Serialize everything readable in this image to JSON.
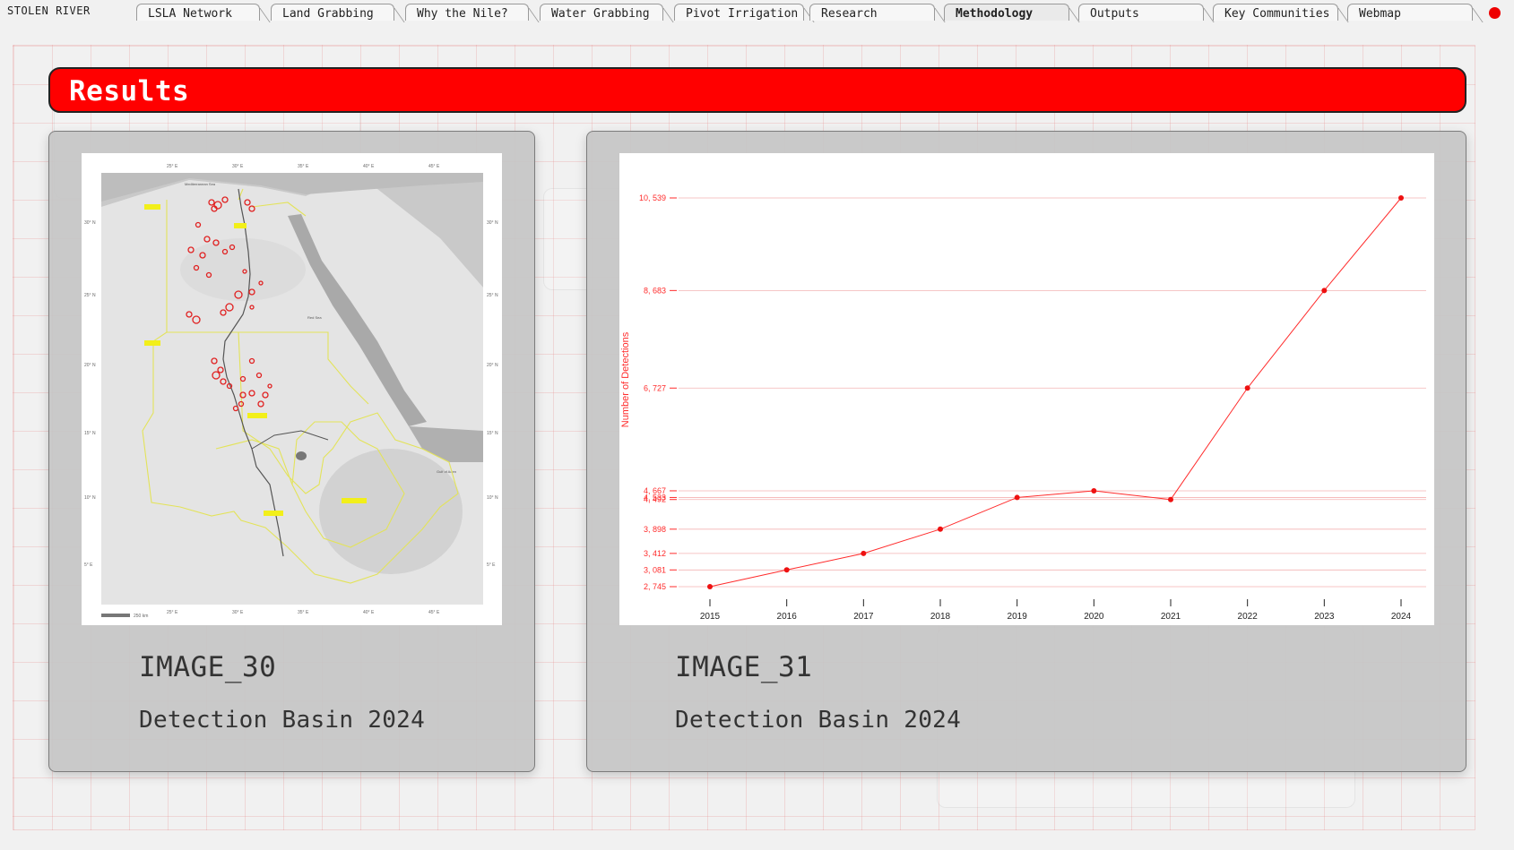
{
  "brand": "STOLEN RIVER",
  "tabs": [
    {
      "label": "LSLA Network",
      "active": false
    },
    {
      "label": "Land Grabbing",
      "active": false
    },
    {
      "label": "Why the Nile?",
      "active": false
    },
    {
      "label": "Water Grabbing",
      "active": false
    },
    {
      "label": "Pivot Irrigation",
      "active": false
    },
    {
      "label": "Research",
      "active": false
    },
    {
      "label": "Methodology",
      "active": true
    },
    {
      "label": "Outputs",
      "active": false
    },
    {
      "label": "Key Communities",
      "active": false
    },
    {
      "label": "Webmap",
      "active": false
    }
  ],
  "colors": {
    "accent": "#ff0000",
    "status_dot": "#ee0000"
  },
  "section_title": "Results",
  "cards": [
    {
      "title": "IMAGE_30",
      "subtitle": "Detection Basin 2024",
      "image": "map of the Nile basin with detection sites",
      "map": {
        "lon_labels": [
          "25° E",
          "30° E",
          "35° E",
          "40° E",
          "45° E"
        ],
        "lat_labels": [
          "30° N",
          "25° N",
          "20° N",
          "15° N",
          "10° N",
          "5° E"
        ],
        "scale_label": "250 km",
        "sea_labels": [
          "Mediterranean Sea",
          "Red Sea",
          "Gulf of Aden"
        ]
      }
    },
    {
      "title": "IMAGE_31",
      "subtitle": "Detection Basin 2024",
      "image": "line chart of number of detections per year"
    }
  ],
  "chart_data": {
    "type": "line",
    "title": "",
    "xlabel": "",
    "ylabel": "Number of Detections",
    "x": [
      2015,
      2016,
      2017,
      2018,
      2019,
      2020,
      2021,
      2022,
      2023,
      2024
    ],
    "x_tick_labels": [
      "2015",
      "2016",
      "2017",
      "2018",
      "2019",
      "2020",
      "2021",
      "2022",
      "2023",
      "2024"
    ],
    "y_tick_labels": [
      "2, 745",
      "3, 081",
      "3, 412",
      "3, 898",
      "4, 533",
      "4, 667",
      "4, 492",
      "6, 727",
      "8, 683",
      "10, 539"
    ],
    "series": [
      {
        "values": [
          2745,
          3081,
          3412,
          3898,
          4533,
          4667,
          4492,
          6727,
          8683,
          10539
        ]
      }
    ],
    "grid": true,
    "color": "#ff2b2b"
  }
}
